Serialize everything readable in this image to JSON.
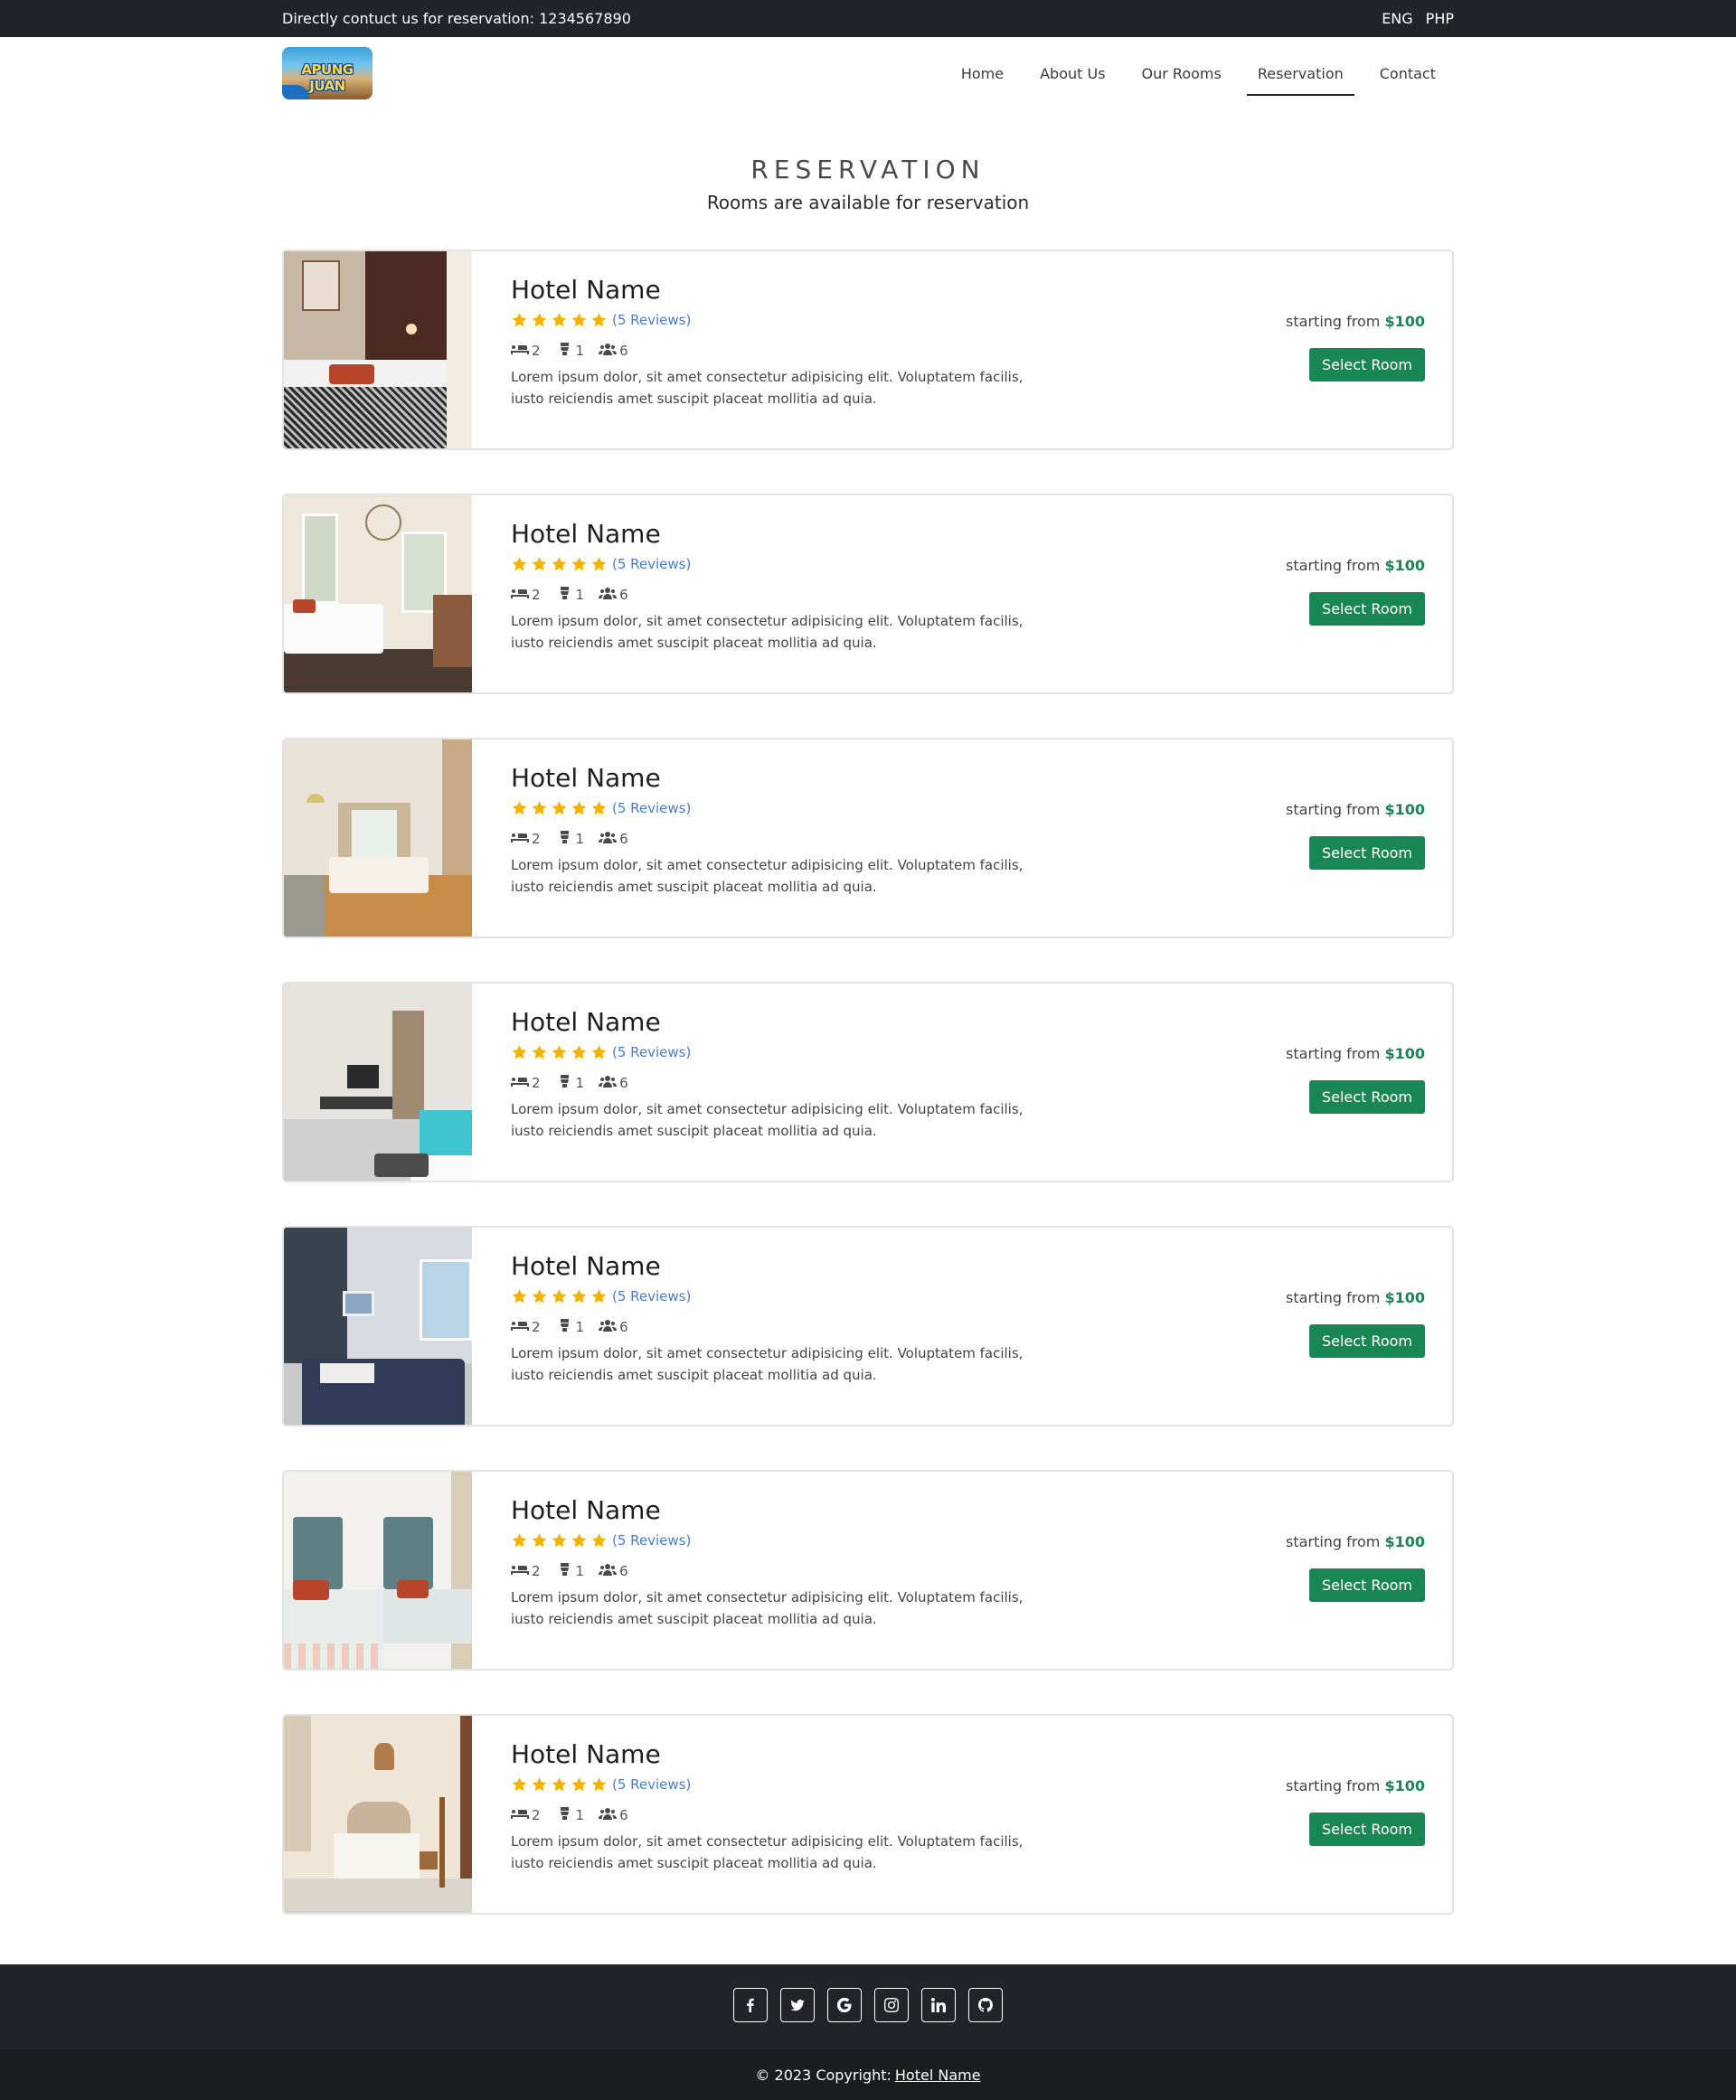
{
  "topbar": {
    "contact": "Directly contuct us for reservation: 1234567890",
    "languages": [
      "ENG",
      "PHP"
    ]
  },
  "logo": {
    "text": "APUNG JUAN"
  },
  "nav": {
    "items": [
      "Home",
      "About Us",
      "Our Rooms",
      "Reservation",
      "Contact"
    ],
    "active": "Reservation"
  },
  "page": {
    "title": "RESERVATION",
    "subtitle": "Rooms are available for reservation"
  },
  "rooms": [
    {
      "name": "Hotel Name",
      "rating": 5,
      "reviews": "(5 Reviews)",
      "beds": "2",
      "baths": "1",
      "guests": "6",
      "description_1": "Lorem ipsum dolor, sit amet consectetur adipisicing elit. Voluptatem facilis,",
      "description_2": "iusto reiciendis amet suscipit placeat mollitia ad quia.",
      "price_label": "starting from",
      "price": "$100",
      "button": "Select Room"
    },
    {
      "name": "Hotel Name",
      "rating": 5,
      "reviews": "(5 Reviews)",
      "beds": "2",
      "baths": "1",
      "guests": "6",
      "description_1": "Lorem ipsum dolor, sit amet consectetur adipisicing elit. Voluptatem facilis,",
      "description_2": "iusto reiciendis amet suscipit placeat mollitia ad quia.",
      "price_label": "starting from",
      "price": "$100",
      "button": "Select Room"
    },
    {
      "name": "Hotel Name",
      "rating": 5,
      "reviews": "(5 Reviews)",
      "beds": "2",
      "baths": "1",
      "guests": "6",
      "description_1": "Lorem ipsum dolor, sit amet consectetur adipisicing elit. Voluptatem facilis,",
      "description_2": "iusto reiciendis amet suscipit placeat mollitia ad quia.",
      "price_label": "starting from",
      "price": "$100",
      "button": "Select Room"
    },
    {
      "name": "Hotel Name",
      "rating": 5,
      "reviews": "(5 Reviews)",
      "beds": "2",
      "baths": "1",
      "guests": "6",
      "description_1": "Lorem ipsum dolor, sit amet consectetur adipisicing elit. Voluptatem facilis,",
      "description_2": "iusto reiciendis amet suscipit placeat mollitia ad quia.",
      "price_label": "starting from",
      "price": "$100",
      "button": "Select Room"
    },
    {
      "name": "Hotel Name",
      "rating": 5,
      "reviews": "(5 Reviews)",
      "beds": "2",
      "baths": "1",
      "guests": "6",
      "description_1": "Lorem ipsum dolor, sit amet consectetur adipisicing elit. Voluptatem facilis,",
      "description_2": "iusto reiciendis amet suscipit placeat mollitia ad quia.",
      "price_label": "starting from",
      "price": "$100",
      "button": "Select Room"
    },
    {
      "name": "Hotel Name",
      "rating": 5,
      "reviews": "(5 Reviews)",
      "beds": "2",
      "baths": "1",
      "guests": "6",
      "description_1": "Lorem ipsum dolor, sit amet consectetur adipisicing elit. Voluptatem facilis,",
      "description_2": "iusto reiciendis amet suscipit placeat mollitia ad quia.",
      "price_label": "starting from",
      "price": "$100",
      "button": "Select Room"
    },
    {
      "name": "Hotel Name",
      "rating": 5,
      "reviews": "(5 Reviews)",
      "beds": "2",
      "baths": "1",
      "guests": "6",
      "description_1": "Lorem ipsum dolor, sit amet consectetur adipisicing elit. Voluptatem facilis,",
      "description_2": "iusto reiciendis amet suscipit placeat mollitia ad quia.",
      "price_label": "starting from",
      "price": "$100",
      "button": "Select Room"
    }
  ],
  "footer": {
    "social": [
      "facebook-icon",
      "twitter-icon",
      "google-icon",
      "instagram-icon",
      "linkedin-icon",
      "github-icon"
    ],
    "copyright_prefix": "© 2023 Copyright:",
    "copyright_link": "Hotel Name"
  },
  "colors": {
    "dark": "#212529",
    "accent_green": "#198754",
    "star": "#f5b301",
    "review_link": "#4a7bd0"
  }
}
